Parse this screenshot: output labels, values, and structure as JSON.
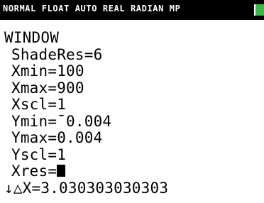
{
  "status_bar": {
    "text": "NORMAL FLOAT AUTO REAL RADIAN MP",
    "battery_icon": "battery-icon",
    "battery_color": "#3cb84a"
  },
  "window_menu": {
    "title": "WINDOW",
    "fields": [
      "ShadeRes=6",
      "Xmin=100",
      "Xmax=900",
      "Xscl=1",
      "Ymin=¯0.004",
      "Ymax=0.004",
      "Yscl=1",
      "Xres="
    ],
    "cursor_icon": "block-cursor-icon",
    "footer": "↓△X=3.030303030303"
  }
}
